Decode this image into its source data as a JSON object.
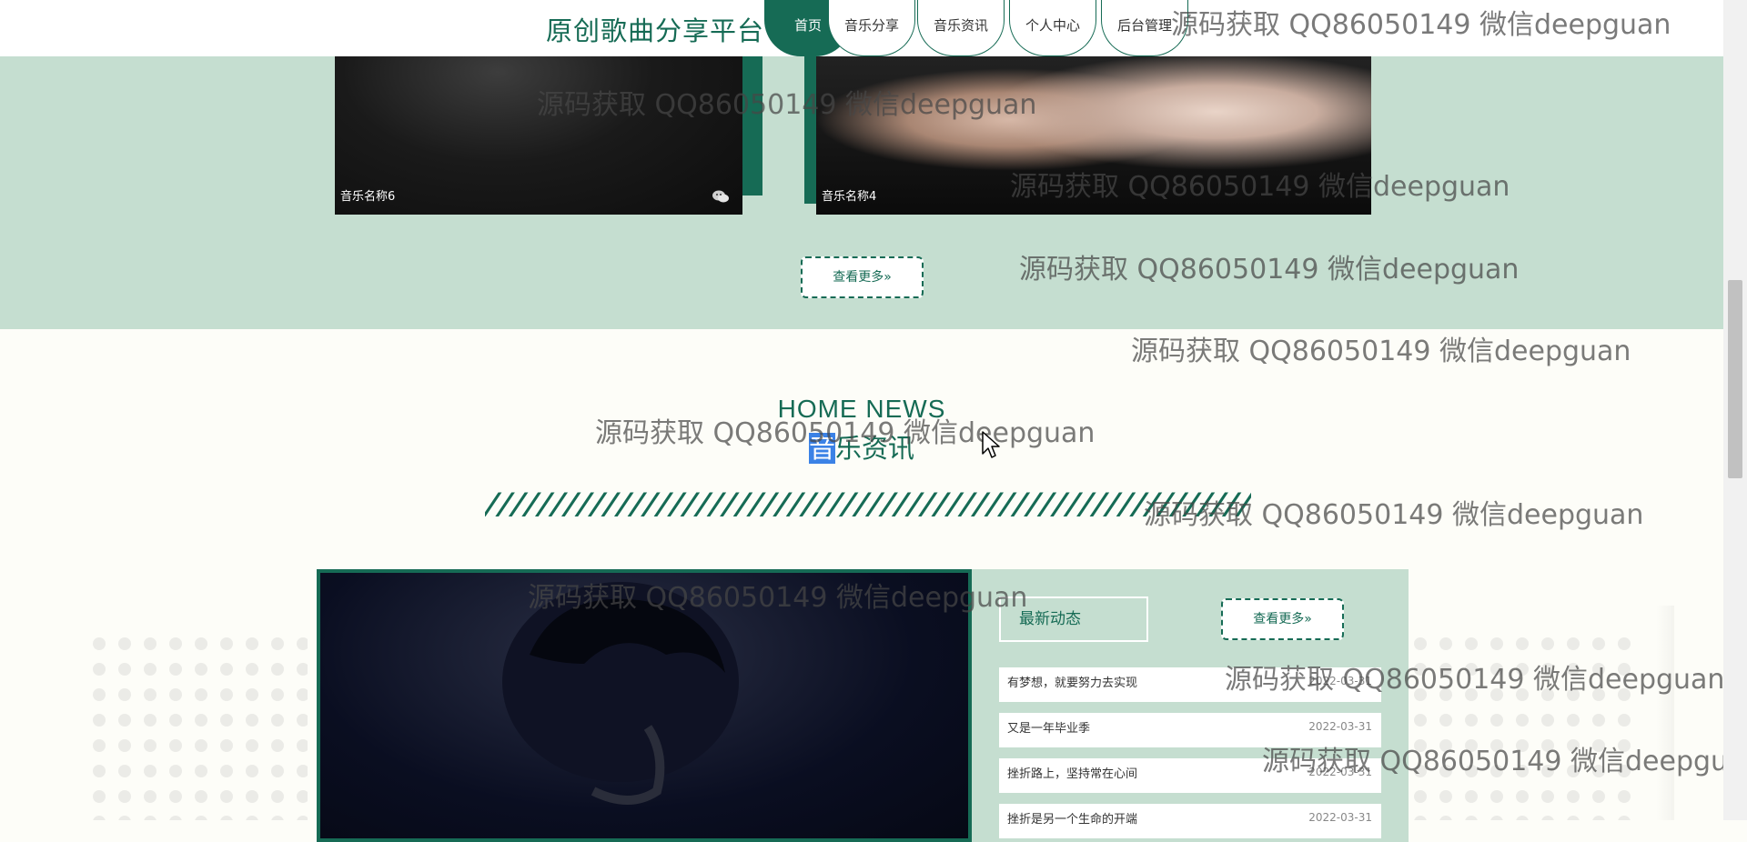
{
  "nav": {
    "site_title": "原创歌曲分享平台",
    "items": [
      {
        "label": "首页",
        "active": true
      },
      {
        "label": "音乐分享"
      },
      {
        "label": "音乐资讯"
      },
      {
        "label": "个人中心"
      },
      {
        "label": "后台管理"
      }
    ]
  },
  "gallery": {
    "cards": [
      {
        "caption": "音乐名称6",
        "icon": "wechat-icon"
      },
      {
        "caption": "音乐名称4"
      }
    ],
    "more_label": "查看更多»"
  },
  "news": {
    "heading_en": "HOME NEWS",
    "heading_cn_selected": "音",
    "heading_cn_rest": "乐资讯",
    "slashes": "//////////////////////////////////////////////////////////",
    "latest_label": "最新动态",
    "more_label": "查看更多»",
    "items": [
      {
        "title": "有梦想，就要努力去实现",
        "date": "2022-03-31"
      },
      {
        "title": "又是一年毕业季",
        "date": "2022-03-31"
      },
      {
        "title": "挫折路上，坚持常在心间",
        "date": "2022-03-31"
      },
      {
        "title": "挫折是另一个生命的开端",
        "date": "2022-03-31"
      }
    ]
  },
  "watermark": {
    "text": "源码获取 QQ86050149 微信deepguan"
  },
  "colors": {
    "brand": "#166b55",
    "band": "#c5ded0",
    "page_bg": "#fdfdf8"
  }
}
